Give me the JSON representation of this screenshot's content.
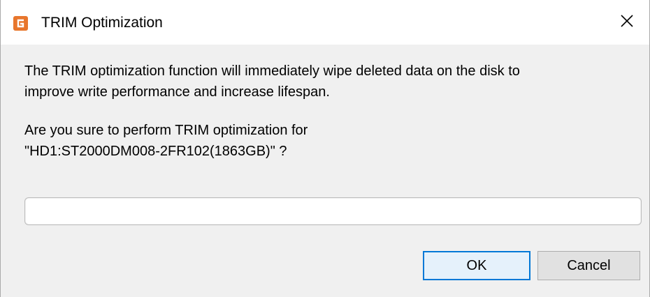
{
  "window": {
    "title": "TRIM Optimization",
    "app_icon": "diskgenius-logo-icon",
    "close_icon": "close-icon"
  },
  "message": {
    "line1": "The TRIM optimization function will immediately wipe deleted data on the disk to",
    "line2": "improve write performance and increase lifespan."
  },
  "question": {
    "line1": "Are you sure to perform TRIM optimization for",
    "line2": "\"HD1:ST2000DM008-2FR102(1863GB)\" ?"
  },
  "progress": {
    "value": 0
  },
  "buttons": {
    "ok_label": "OK",
    "cancel_label": "Cancel"
  },
  "colors": {
    "logo_orange": "#e8762c",
    "ok_border": "#0078d7",
    "ok_background": "#e5f1fb",
    "cancel_background": "#e1e1e1",
    "dialog_background": "#f0f0f0"
  }
}
